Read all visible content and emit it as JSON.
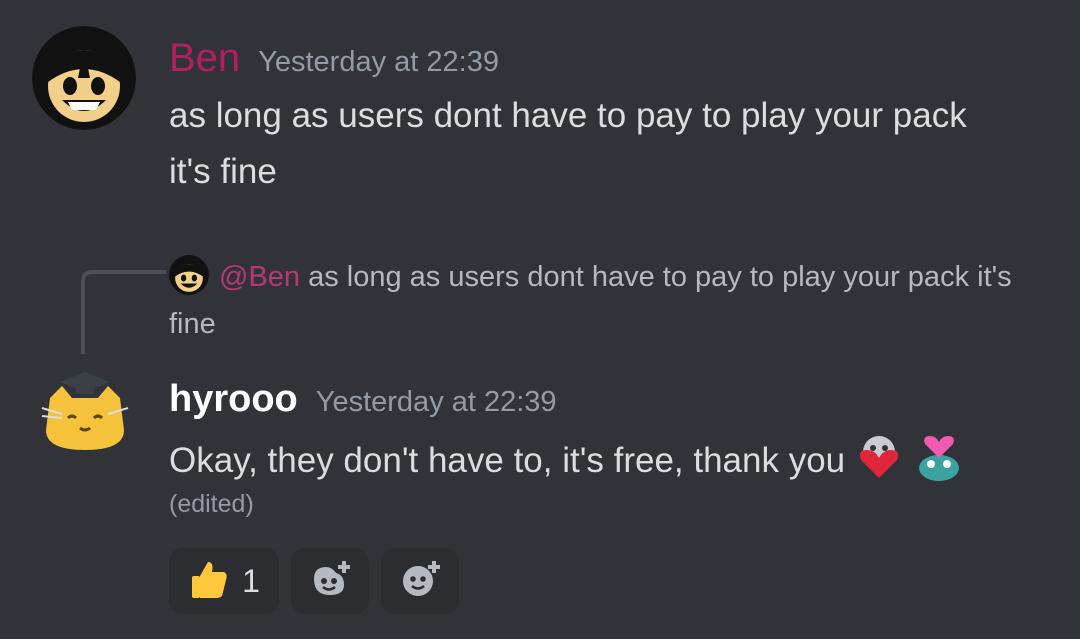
{
  "messages": [
    {
      "author": "Ben",
      "author_color": "#b21f60",
      "timestamp": "Yesterday at 22:39",
      "lines": [
        "as long as users dont have to pay to play your pack",
        "it's fine"
      ],
      "avatar_icon": "bendy-face-icon"
    },
    {
      "author": "hyrooo",
      "author_color": "#ffffff",
      "timestamp": "Yesterday at 22:39",
      "text": "Okay, they don't have to, it's free, thank you",
      "edited_label": "(edited)",
      "avatar_icon": "cat-graduation-cap-icon",
      "inline_emojis": [
        "heart-hug-emoji",
        "frog-heart-emoji"
      ],
      "reply": {
        "mention": "@Ben",
        "text": "as long as users dont have to pay to play your pack it's fine"
      },
      "reactions": [
        {
          "emoji": "thumbs-up-icon",
          "count": "1"
        },
        {
          "emoji": "add-reaction-icon",
          "count": ""
        },
        {
          "emoji": "add-super-reaction-icon",
          "count": ""
        }
      ]
    }
  ]
}
